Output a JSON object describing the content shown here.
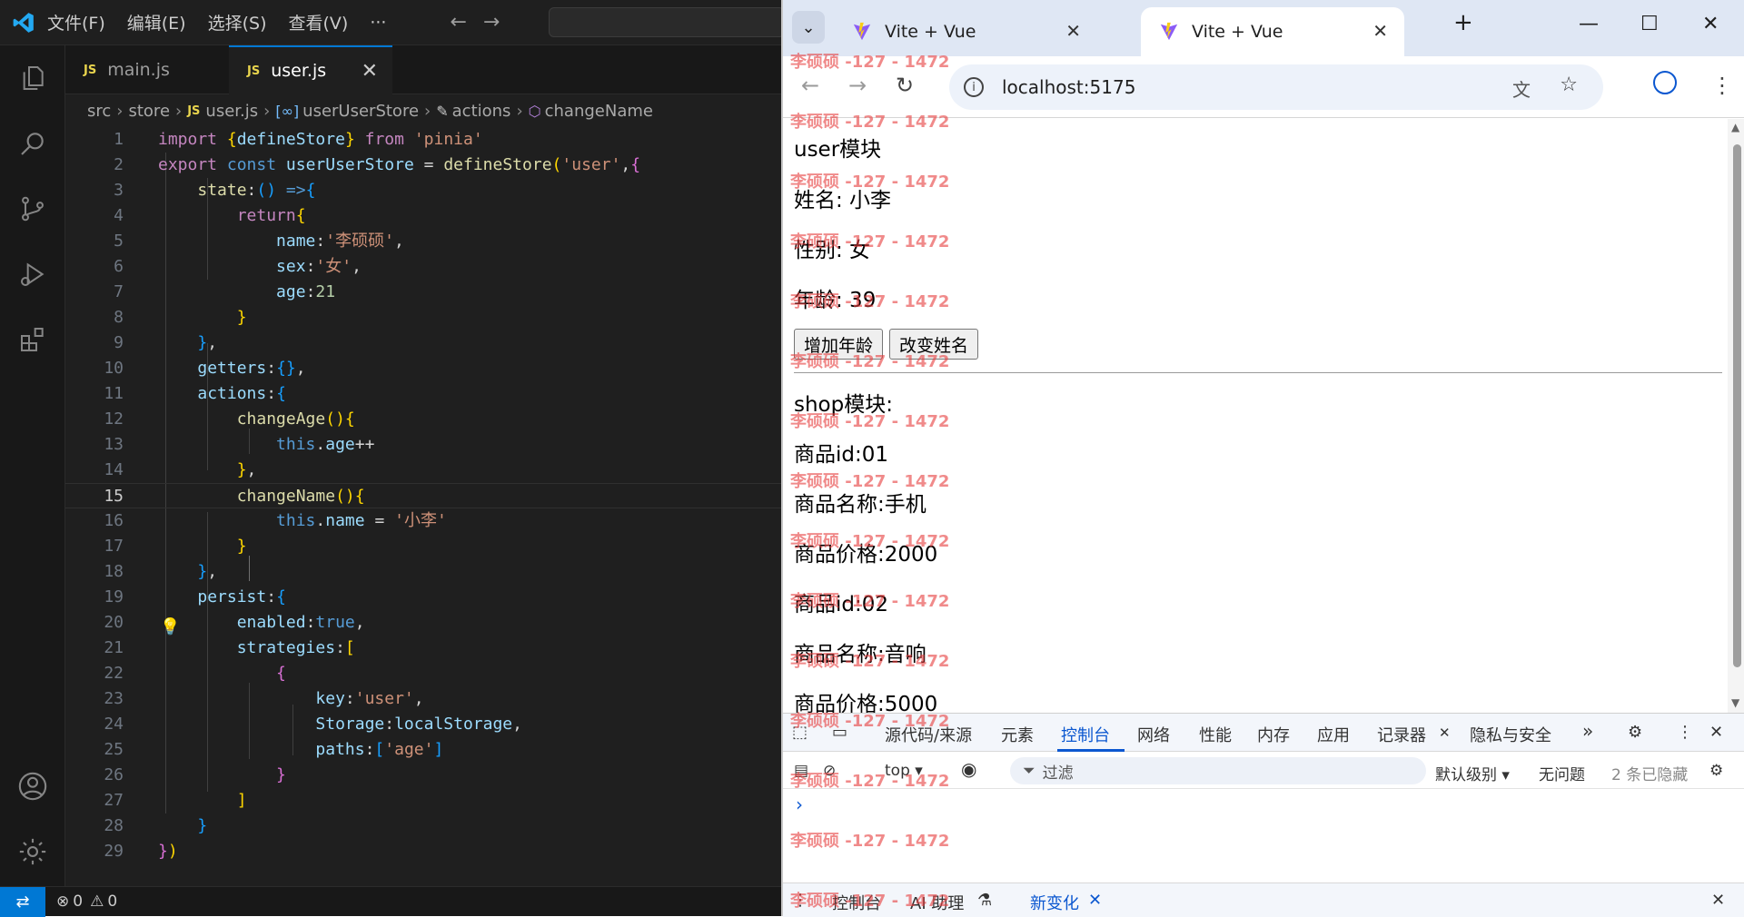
{
  "vscode": {
    "menu": [
      "文件(F)",
      "编辑(E)",
      "选择(S)",
      "查看(V)"
    ],
    "more": "···",
    "tabs": [
      {
        "label": "main.js",
        "badge": "JS"
      },
      {
        "label": "user.js",
        "badge": "JS",
        "close": "✕"
      }
    ],
    "breadcrumb": {
      "src": "src",
      "store": "store",
      "file": "user.js",
      "symbol": "userUserStore",
      "actions": "actions",
      "method": "changeName"
    },
    "status": {
      "errors": "0",
      "warnings": "0"
    }
  },
  "browser": {
    "tabs": [
      {
        "label": "Vite + Vue",
        "close": "✕"
      },
      {
        "label": "Vite + Vue",
        "close": "✕"
      }
    ],
    "new_tab": "+",
    "url": "localhost:5175",
    "page": {
      "user_title": "user模块",
      "name": "姓名: 小李",
      "sex": "性别: 女",
      "age": "年龄: 39",
      "btn_add_age": "增加年龄",
      "btn_change_name": "改变姓名",
      "shop_title": "shop模块:",
      "item1_id": "商品id:01",
      "item1_name": "商品名称:手机",
      "item1_price": "商品价格:2000",
      "item2_id": "商品id:02",
      "item2_name": "商品名称:音响",
      "item2_price": "商品价格:5000"
    },
    "devtools": {
      "tabs": [
        "源代码/来源",
        "元素",
        "控制台",
        "网络",
        "性能",
        "内存",
        "应用",
        "记录器",
        "隐私与安全"
      ],
      "more": "»",
      "context": "top",
      "filter_placeholder": "过滤",
      "level": "默认级别",
      "issues": "无问题",
      "hidden": "2 条已隐藏",
      "prompt": "›",
      "drawer": [
        "控制台",
        "AI 助理",
        "新变化"
      ]
    }
  },
  "watermark": "李硕硕 -127 - 1472"
}
